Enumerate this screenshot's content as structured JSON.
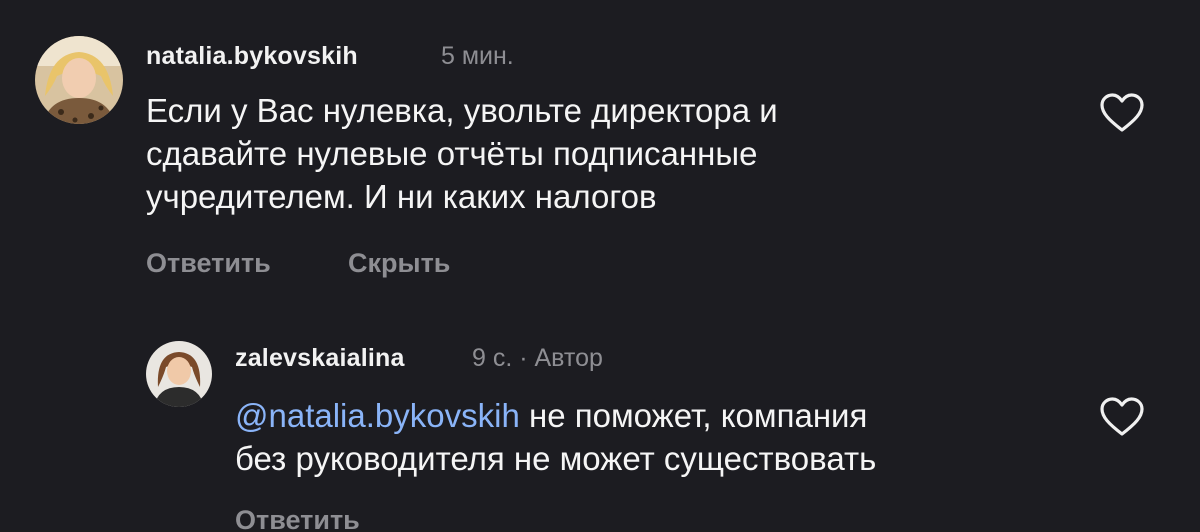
{
  "comments": [
    {
      "username": "natalia.bykovskih",
      "meta": "5 мин.",
      "lines": [
        "Если у Вас нулевка, увольте директора и",
        "сдавайте нулевые отчёты подписанные",
        "учредителем. И ни каких налогов"
      ],
      "actions": {
        "reply": "Ответить",
        "hide": "Скрыть"
      },
      "avatar_icon": "user-photo-blonde-woman",
      "like_icon": "heart-outline-icon"
    }
  ],
  "reply": {
    "username": "zalevskaialina",
    "meta": "9 с. · Автор",
    "mention": "@natalia.bykovskih",
    "line1_rest": " не поможет, компания",
    "line2": "без руководителя не может существовать",
    "actions": {
      "reply": "Ответить"
    },
    "avatar_icon": "user-photo-dark-haired-woman",
    "like_icon": "heart-outline-icon"
  },
  "colors": {
    "background": "#1c1c21",
    "text": "#f5f5f5",
    "muted": "#8e8e93",
    "mention": "#8ab4f8"
  }
}
